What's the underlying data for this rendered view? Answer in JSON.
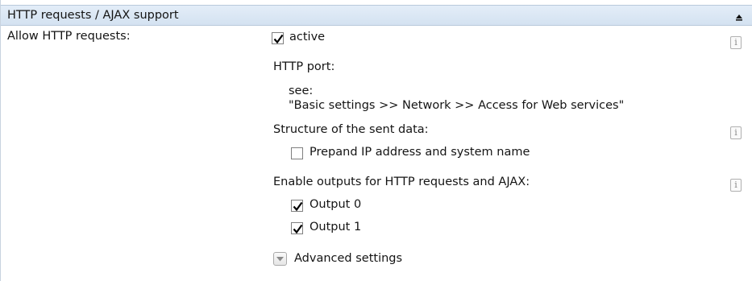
{
  "section": {
    "title": "HTTP requests / AJAX support",
    "collapse_icon": "chevron-up-icon"
  },
  "allow_http": {
    "label": "Allow HTTP requests:",
    "active_label": "active",
    "active_checked": true
  },
  "http_port": {
    "label": "HTTP port:",
    "see": "see:",
    "reference": "\"Basic settings >> Network >> Access for Web services\""
  },
  "structure": {
    "label": "Structure of the sent data:",
    "prepend_label": "Prepand IP address and system name",
    "prepend_checked": false
  },
  "outputs": {
    "label": "Enable outputs for HTTP requests and AJAX:",
    "items": [
      {
        "label": "Output 0",
        "checked": true
      },
      {
        "label": "Output 1",
        "checked": true
      }
    ]
  },
  "advanced": {
    "label": "Advanced settings",
    "icon": "chevron-down-icon"
  },
  "info_icon_glyph": "i",
  "colors": {
    "header_bg": "#d9e6f3",
    "border": "#b9c9db",
    "check": "#000000"
  }
}
